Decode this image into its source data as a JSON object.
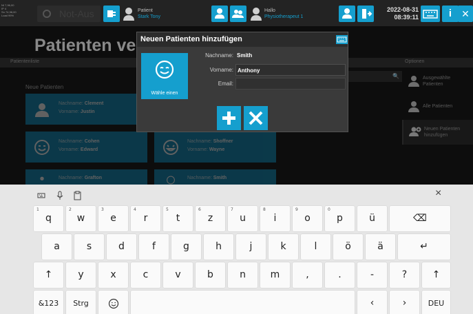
{
  "top_bar": {
    "status_lines": [
      "NI 7,96,00",
      "IP 4",
      "Sn 74,98,00",
      "Load 99%"
    ],
    "emergency_stop_label": "Not-Aus",
    "patient_caption": "Patient",
    "patient_name": "Stark Tony",
    "greeting_caption": "Hallo",
    "user_role": "Physiotherapeut 1",
    "date": "2022-08-31",
    "time": "08:39:11",
    "info_label": "i",
    "close_label": "✕"
  },
  "page": {
    "title": "Patienten ver",
    "list_header": "Patientenliste",
    "new_patients_label": "Neue Patienten",
    "options_header": "Optionen"
  },
  "patient_cards": [
    {
      "lastname_label": "Nachname:",
      "lastname": "Clement",
      "firstname_label": "Vorname:",
      "firstname": "Justin"
    },
    {
      "lastname_label": "Nachname:",
      "lastname": "Cohen",
      "firstname_label": "Vorname:",
      "firstname": "Edward"
    },
    {
      "lastname_label": "Nachname:",
      "lastname": "Shoffner",
      "firstname_label": "Vorname:",
      "firstname": "Wayne"
    },
    {
      "lastname_label": "Nachname:",
      "lastname": "Grafton",
      "firstname_label": "",
      "firstname": ""
    },
    {
      "lastname_label": "Nachname:",
      "lastname": "Smith",
      "firstname_label": "",
      "firstname": ""
    }
  ],
  "options": [
    {
      "label": "Ausgewählte Patienten"
    },
    {
      "label": "Alle Patienten"
    },
    {
      "label": "Neuen Patienten hinzufügen"
    }
  ],
  "dialog": {
    "title": "Neuen Patienten hinzufügen",
    "photo_label": "Wähle einen",
    "fields": {
      "lastname_label": "Nachname:",
      "lastname_value": "Smith",
      "firstname_label": "Vorname:",
      "firstname_value": "Anthony",
      "email_label": "Email:",
      "email_value": ""
    },
    "confirm_icon": "plus-icon",
    "cancel_icon": "x-icon"
  },
  "keyboard": {
    "close_label": "×",
    "row1": [
      {
        "key": "q",
        "hint": "1"
      },
      {
        "key": "w",
        "hint": "2"
      },
      {
        "key": "e",
        "hint": "3"
      },
      {
        "key": "r",
        "hint": "4"
      },
      {
        "key": "t",
        "hint": "5"
      },
      {
        "key": "z",
        "hint": "6"
      },
      {
        "key": "u",
        "hint": "7"
      },
      {
        "key": "i",
        "hint": "8"
      },
      {
        "key": "o",
        "hint": "9"
      },
      {
        "key": "p",
        "hint": "0"
      },
      {
        "key": "ü",
        "hint": ""
      }
    ],
    "backspace": "⌫",
    "row2": [
      "a",
      "s",
      "d",
      "f",
      "g",
      "h",
      "j",
      "k",
      "l",
      "ö",
      "ä"
    ],
    "enter": "↵",
    "shift": "↑",
    "row3": [
      "y",
      "x",
      "c",
      "v",
      "b",
      "n",
      "m",
      ",",
      ".",
      "-",
      "?"
    ],
    "mode_label": "&123",
    "ctrl_label": "Strg",
    "left_label": "‹",
    "right_label": "›",
    "lang_label": "DEU"
  },
  "colors": {
    "accent": "#159fce",
    "background": "#141414",
    "keyboard": "#e6e6e6"
  }
}
